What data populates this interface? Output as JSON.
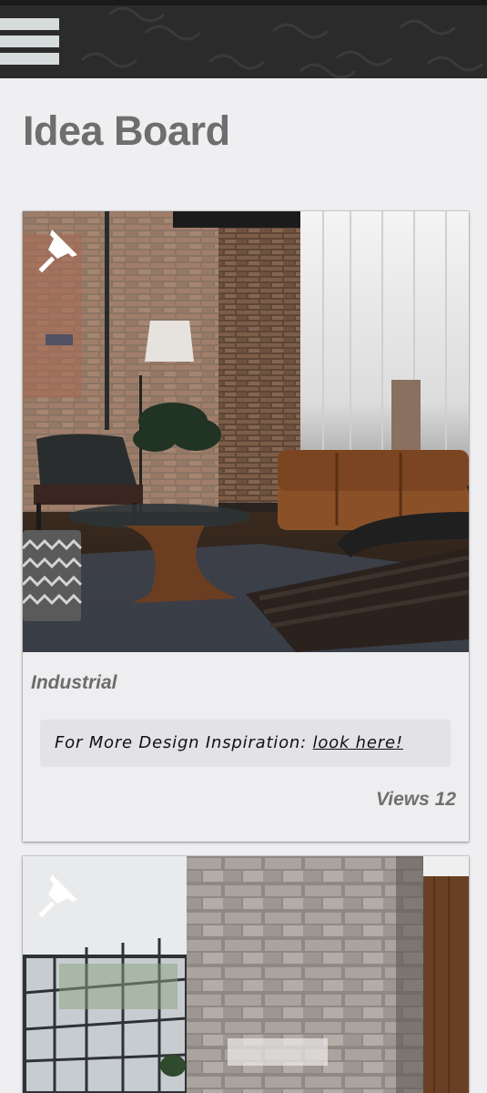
{
  "header": {
    "menu_icon": "hamburger-menu-icon",
    "colors": {
      "bar": "#2a2a2b",
      "menu": "#d6dbdb"
    }
  },
  "page": {
    "title": "Idea Board"
  },
  "cards": [
    {
      "title": "Industrial",
      "pin_icon": "pushpin-icon",
      "inspiration_prefix": "For More Design Inspiration: ",
      "inspiration_link": "look here!",
      "views_label": "Views",
      "views_count": "12",
      "image": "industrial-living-room-photo"
    },
    {
      "pin_icon": "pushpin-icon",
      "image": "stone-wall-interior-photo"
    }
  ]
}
